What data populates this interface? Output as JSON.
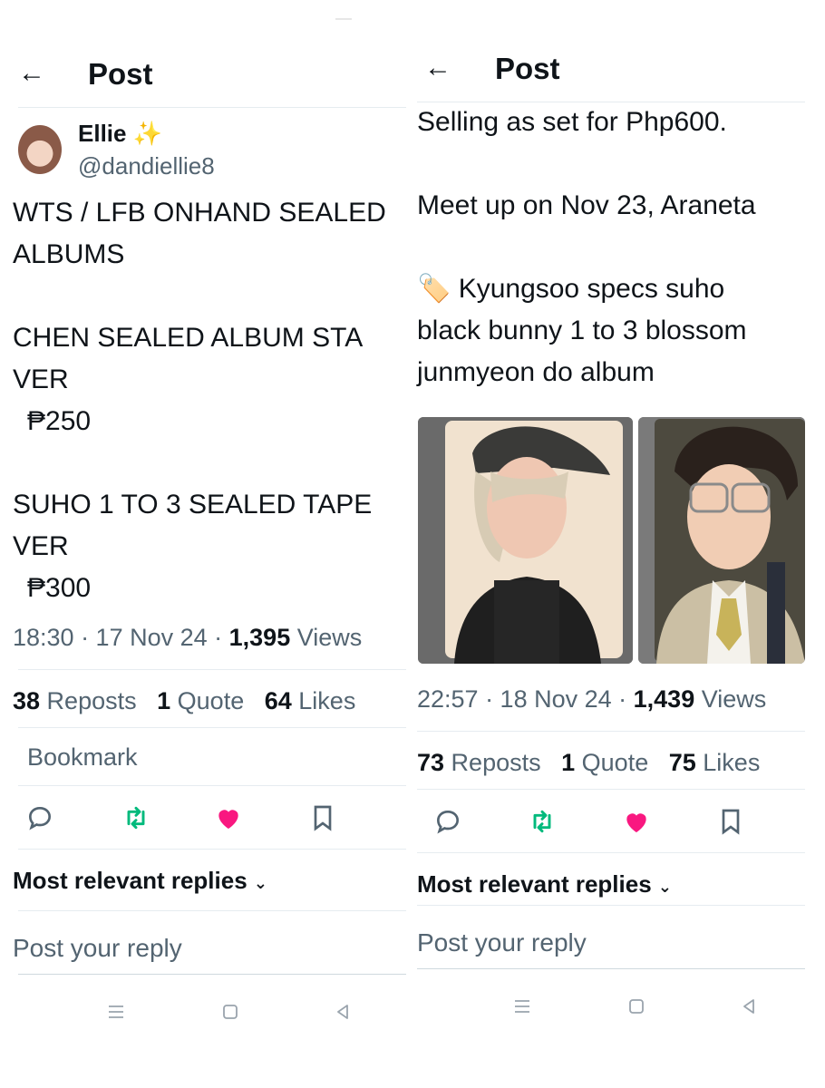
{
  "left": {
    "header": {
      "back_glyph": "←",
      "title": "Post"
    },
    "author": {
      "name": "Ellie",
      "sparkle": "✨",
      "handle": "@dandiellie8"
    },
    "body_lines": [
      "WTS / LFB ONHAND SEALED",
      "ALBUMS",
      "CHEN SEALED ALBUM STA",
      "VER",
      "₱250",
      "SUHO 1 TO 3 SEALED TAPE",
      "VER",
      "₱300"
    ],
    "meta": {
      "time": "18:30 · 17 Nov 24 · ",
      "views_count": "1,395",
      "views_label": " Views"
    },
    "stats": {
      "reposts_count": "38",
      "reposts_label": " Reposts",
      "quotes_count": "1",
      "quotes_label": " Quote",
      "likes_count": "64",
      "likes_label": " Likes"
    },
    "bookmark_label": "Bookmark",
    "replies_label": "Most relevant replies",
    "reply_placeholder": "Post your reply"
  },
  "right": {
    "header": {
      "back_glyph": "←",
      "title": "Post"
    },
    "body_lines": [
      "Selling as set for Php600.",
      "Meet up on Nov 23, Araneta",
      "🏷️ Kyungsoo specs suho",
      "black bunny 1 to 3 blossom",
      "junmyeon do album"
    ],
    "meta": {
      "time": "22:57 · 18 Nov 24 · ",
      "views_count": "1,439",
      "views_label": " Views"
    },
    "stats": {
      "reposts_count": "73",
      "reposts_label": " Reposts",
      "quotes_count": "1",
      "quotes_label": " Quote",
      "likes_count": "75",
      "likes_label": " Likes"
    },
    "replies_label": "Most relevant replies",
    "reply_placeholder": "Post your reply"
  },
  "colors": {
    "accent_like": "#f91880",
    "accent_repost": "#00ba7c",
    "muted": "#536471",
    "border": "#e6ecf0"
  },
  "icons": [
    "reply-icon",
    "repost-icon",
    "like-icon",
    "bookmark-icon",
    "menu-nav-icon",
    "home-nav-icon",
    "back-nav-icon"
  ]
}
